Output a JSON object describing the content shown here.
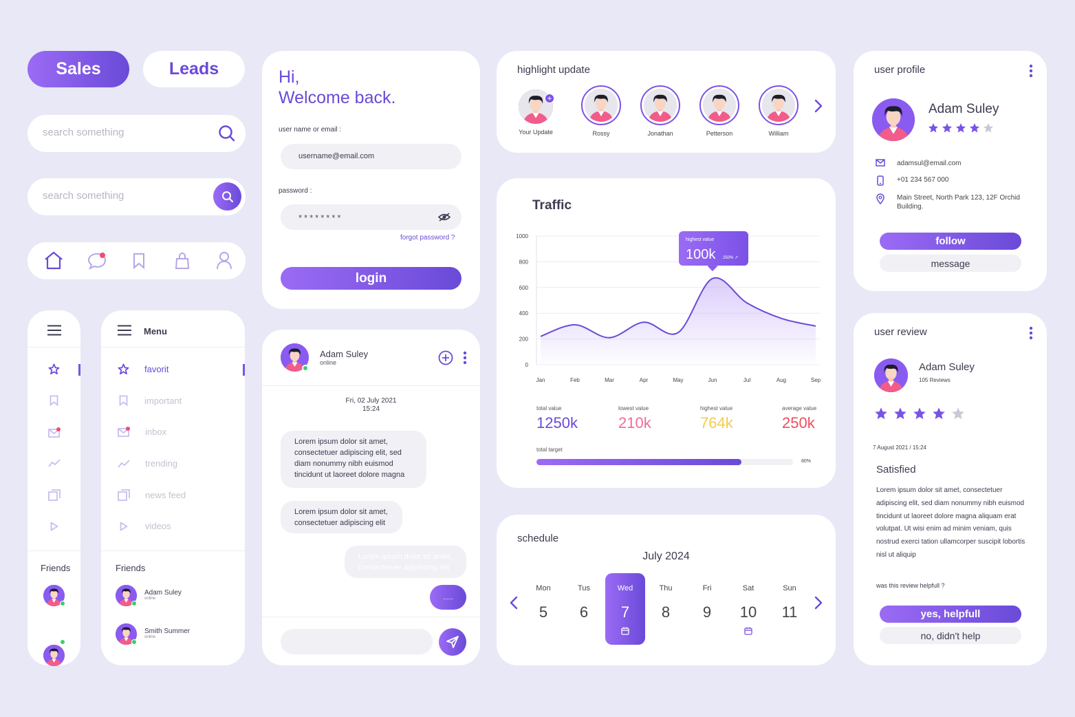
{
  "tabs": {
    "sales": "Sales",
    "leads": "Leads"
  },
  "search": {
    "placeholder1": "search something",
    "placeholder2": "search something"
  },
  "login": {
    "greeting_line1": "Hi,",
    "greeting_line2": "Welcome back.",
    "username_label": "user name or email :",
    "username_value": "username@email.com",
    "password_label": "password :",
    "password_value": "********",
    "forgot": "forgot password ?",
    "login_btn": "login"
  },
  "highlight": {
    "title": "highlight update",
    "stories": [
      {
        "name": "Your Update"
      },
      {
        "name": "Rossy"
      },
      {
        "name": "Jonathan"
      },
      {
        "name": "Petterson"
      },
      {
        "name": "William"
      }
    ]
  },
  "profile": {
    "title": "user profile",
    "name": "Adam Suley",
    "rating": 4,
    "email": "adamsul@email.com",
    "phone": "+01 234 567 000",
    "address": "Main Street, North Park 123, 12F Orchid Building.",
    "follow": "follow",
    "message": "message"
  },
  "traffic": {
    "title": "Traffic",
    "tooltip_label": "highest value",
    "tooltip_value": "100k",
    "tooltip_pct": "250% ↗",
    "stats": [
      {
        "label": "total value",
        "value": "1250k",
        "color": "#6a4ad8"
      },
      {
        "label": "lowest value",
        "value": "210k",
        "color": "#f06b9b"
      },
      {
        "label": "highest value",
        "value": "764k",
        "color": "#f5cc4a"
      },
      {
        "label": "average value",
        "value": "250k",
        "color": "#f04d5e"
      }
    ],
    "target_label": "total target",
    "target_pct_text": "80%",
    "target_fraction": 0.8
  },
  "chart_data": {
    "type": "area",
    "title": "Traffic",
    "categories": [
      "Jan",
      "Feb",
      "Mar",
      "Apr",
      "May",
      "Jun",
      "Jul",
      "Aug",
      "Sep"
    ],
    "y_ticks": [
      0,
      200,
      400,
      600,
      800,
      1000
    ],
    "ylim": [
      0,
      1000
    ],
    "series": [
      {
        "values": [
          220,
          310,
          210,
          330,
          250,
          670,
          480,
          360,
          300
        ]
      }
    ],
    "annotation": {
      "category": "Jun",
      "label": "highest value",
      "value": "100k",
      "pct": "250%"
    },
    "grid": true
  },
  "sidebar": {
    "friends": "Friends",
    "menu_title": "Menu",
    "items": [
      {
        "label": "favorit"
      },
      {
        "label": "important"
      },
      {
        "label": "inbox"
      },
      {
        "label": "trending"
      },
      {
        "label": "news feed"
      },
      {
        "label": "videos"
      }
    ],
    "friend_list": [
      {
        "name": "Adam Suley",
        "status": "online"
      },
      {
        "name": "Smith Summer",
        "status": "online"
      }
    ]
  },
  "chat": {
    "name": "Adam Suley",
    "status": "online",
    "date": "Fri, 02 July 2021",
    "time": "15:24",
    "msg1": "Lorem ipsum dolor sit amet, consectetuer adipiscing elit, sed diam nonummy nibh euismod tincidunt ut laoreet dolore magna",
    "msg2": "Lorem ipsum dolor sit amet, consectetuer adipiscing elit",
    "msg3": "Lorem ipsum dolor sit amet, consectetuer adipiscing elit",
    "typing": "......"
  },
  "schedule": {
    "title": "schedule",
    "month": "July 2024",
    "days": [
      {
        "name": "Mon",
        "num": "5"
      },
      {
        "name": "Tus",
        "num": "6"
      },
      {
        "name": "Wed",
        "num": "7"
      },
      {
        "name": "Thu",
        "num": "8"
      },
      {
        "name": "Fri",
        "num": "9"
      },
      {
        "name": "Sat",
        "num": "10"
      },
      {
        "name": "Sun",
        "num": "11"
      }
    ]
  },
  "review": {
    "title": "user review",
    "name": "Adam Suley",
    "count": "105 Reviews",
    "rating": 4,
    "date": "7 August 2021 / 15:24",
    "headline": "Satisfied",
    "body": "Lorem ipsum dolor sit amet, consectetuer adipiscing elit, sed diam nonummy nibh euismod tincidunt ut laoreet dolore magna aliquam erat volutpat. Ut wisi enim ad minim veniam, quis nostrud exerci tation ullamcorper suscipit lobortis nisl ut aliquip",
    "question": "was this review helpfull ?",
    "yes": "yes, helpfull",
    "no": "no, didn't help"
  },
  "colors": {
    "accent": "#7a52e6",
    "accent_light": "#9b6bf5",
    "bg": "#e8e8f6"
  }
}
